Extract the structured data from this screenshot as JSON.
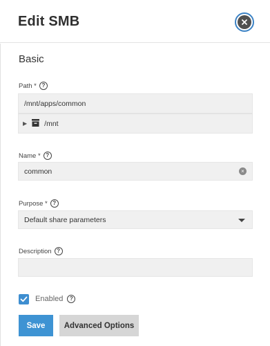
{
  "dialog": {
    "title": "Edit SMB",
    "close_icon": "close-circle-icon"
  },
  "section": {
    "title": "Basic"
  },
  "path": {
    "label": "Path *",
    "value": "/mnt/apps/common",
    "tree_node": "/mnt",
    "tree_icon": "dataset-icon"
  },
  "name": {
    "label": "Name *",
    "value": "common"
  },
  "purpose": {
    "label": "Purpose *",
    "selected": "Default share parameters"
  },
  "description": {
    "label": "Description",
    "value": ""
  },
  "enabled": {
    "label": "Enabled",
    "checked": true
  },
  "buttons": {
    "save": "Save",
    "advanced": "Advanced Options"
  },
  "colors": {
    "accent": "#3e93d3",
    "field_bg": "#f0f0f0",
    "secondary_button": "#d6d6d6"
  }
}
